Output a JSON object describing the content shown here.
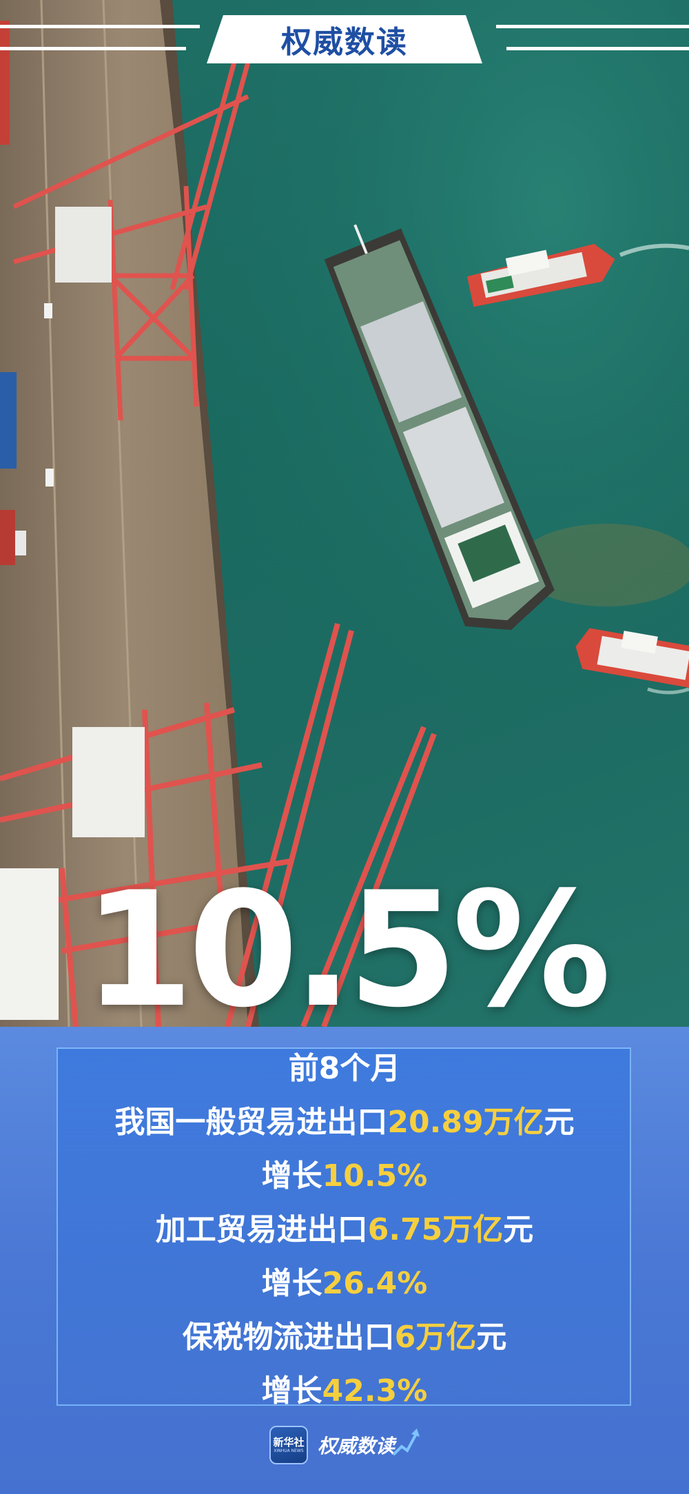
{
  "banner": {
    "title": "权威数读"
  },
  "hero": {
    "big_number": "10.5%"
  },
  "details": {
    "period": "前8个月",
    "general_trade": {
      "prefix": "我国一般贸易进出口",
      "value": "20.89万亿",
      "unit": "元"
    },
    "general_growth": {
      "prefix": "增长",
      "value": "10.5%"
    },
    "processing_trade": {
      "prefix": "加工贸易进出口",
      "value": "6.75万亿",
      "unit": "元"
    },
    "processing_growth": {
      "prefix": "增长",
      "value": "26.4%"
    },
    "bonded_logistics": {
      "prefix": "保税物流进出口",
      "value": "6万亿",
      "unit": "元"
    },
    "bonded_growth": {
      "prefix": "增长",
      "value": "42.3%"
    }
  },
  "footer": {
    "badge_text": "新华社",
    "badge_subtext": "XINHUA NEWS",
    "brand_text": "权威数读"
  },
  "colors": {
    "highlight": "#f6cf3f",
    "brand_blue": "#1f4fa3",
    "panel_blue": "#4a78d4",
    "water": "#1d6b62",
    "crane_red": "#e0534e"
  }
}
